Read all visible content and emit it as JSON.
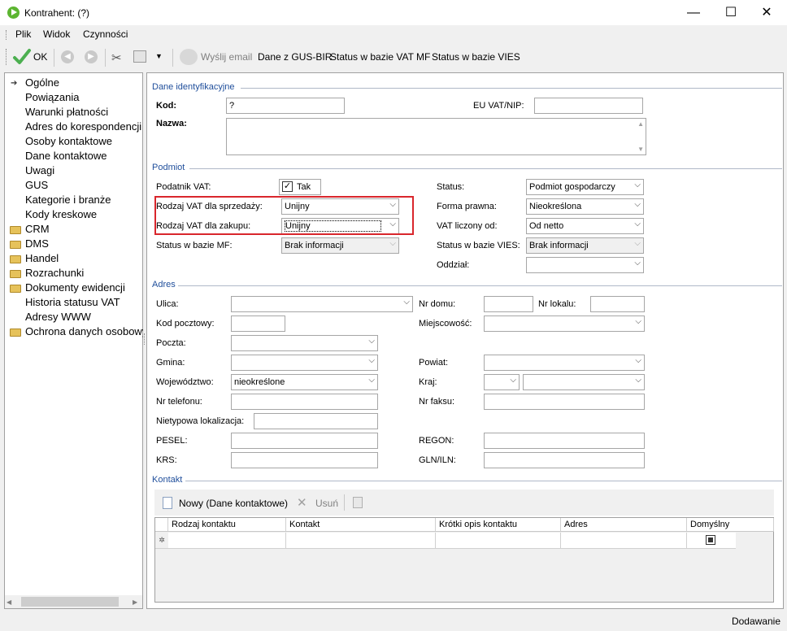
{
  "window": {
    "title": "Kontrahent:  (?)",
    "minimize": "—",
    "maximize": "☐",
    "close": "✕"
  },
  "menu": [
    "Plik",
    "Widok",
    "Czynności"
  ],
  "toolbar": {
    "ok": "OK",
    "send_email": "Wyślij email",
    "gus": "Dane z GUS-BIR",
    "vat_mf": "Status w bazie VAT MF",
    "vies": "Status w bazie VIES"
  },
  "sidebar": {
    "items": [
      "Ogólne",
      "Powiązania",
      "Warunki płatności",
      "Adres do korespondencji",
      "Osoby kontaktowe",
      "Dane kontaktowe",
      "Uwagi",
      "GUS",
      "Kategorie i branże",
      "Kody kreskowe"
    ],
    "folders": [
      "CRM",
      "DMS",
      "Handel",
      "Rozrachunki",
      "Dokumenty ewidencji"
    ],
    "items2": [
      "Historia statusu VAT",
      "Adresy WWW"
    ],
    "folders2": [
      "Ochrona danych osobowych"
    ]
  },
  "sections": {
    "ident": "Dane identyfikacyjne",
    "podmiot": "Podmiot",
    "adres": "Adres",
    "kontakt": "Kontakt"
  },
  "ident": {
    "kod_label": "Kod:",
    "kod_value": "?",
    "nazwa_label": "Nazwa:",
    "euvat_label": "EU VAT/NIP:"
  },
  "podmiot": {
    "vat_label": "Podatnik VAT:",
    "vat_check": "Tak",
    "sprzedazy_label": "Rodzaj VAT dla sprzedaży:",
    "sprzedazy_value": "Unijny",
    "zakupu_label": "Rodzaj VAT dla zakupu:",
    "zakupu_value": "Unijny",
    "mf_label": "Status w bazie MF:",
    "mf_value": "Brak informacji",
    "status_label": "Status:",
    "status_value": "Podmiot gospodarczy",
    "forma_label": "Forma prawna:",
    "forma_value": "Nieokreślona",
    "vatod_label": "VAT liczony od:",
    "vatod_value": "Od netto",
    "vies_label": "Status w bazie VIES:",
    "vies_value": "Brak informacji",
    "oddzial_label": "Oddział:"
  },
  "adres": {
    "ulica": "Ulica:",
    "nr_domu": "Nr domu:",
    "nr_lokalu": "Nr lokalu:",
    "kod": "Kod pocztowy:",
    "miejscowosc": "Miejscowość:",
    "poczta": "Poczta:",
    "gmina": "Gmina:",
    "powiat": "Powiat:",
    "woj": "Województwo:",
    "woj_value": "nieokreślone",
    "kraj": "Kraj:",
    "tel": "Nr telefonu:",
    "faks": "Nr faksu:",
    "nietyp": "Nietypowa lokalizacja:",
    "pesel": "PESEL:",
    "regon": "REGON:",
    "krs": "KRS:",
    "gln": "GLN/ILN:"
  },
  "kontakt": {
    "new_btn": "Nowy (Dane kontaktowe)",
    "delete_btn": "Usuń",
    "columns": [
      "Rodzaj kontaktu",
      "Kontakt",
      "Krótki opis kontaktu",
      "Adres",
      "Domyślny"
    ]
  },
  "status": "Dodawanie",
  "colors": {
    "highlight": "#d9262c",
    "section": "#1f4e9b",
    "ok_green": "#4caf50"
  }
}
